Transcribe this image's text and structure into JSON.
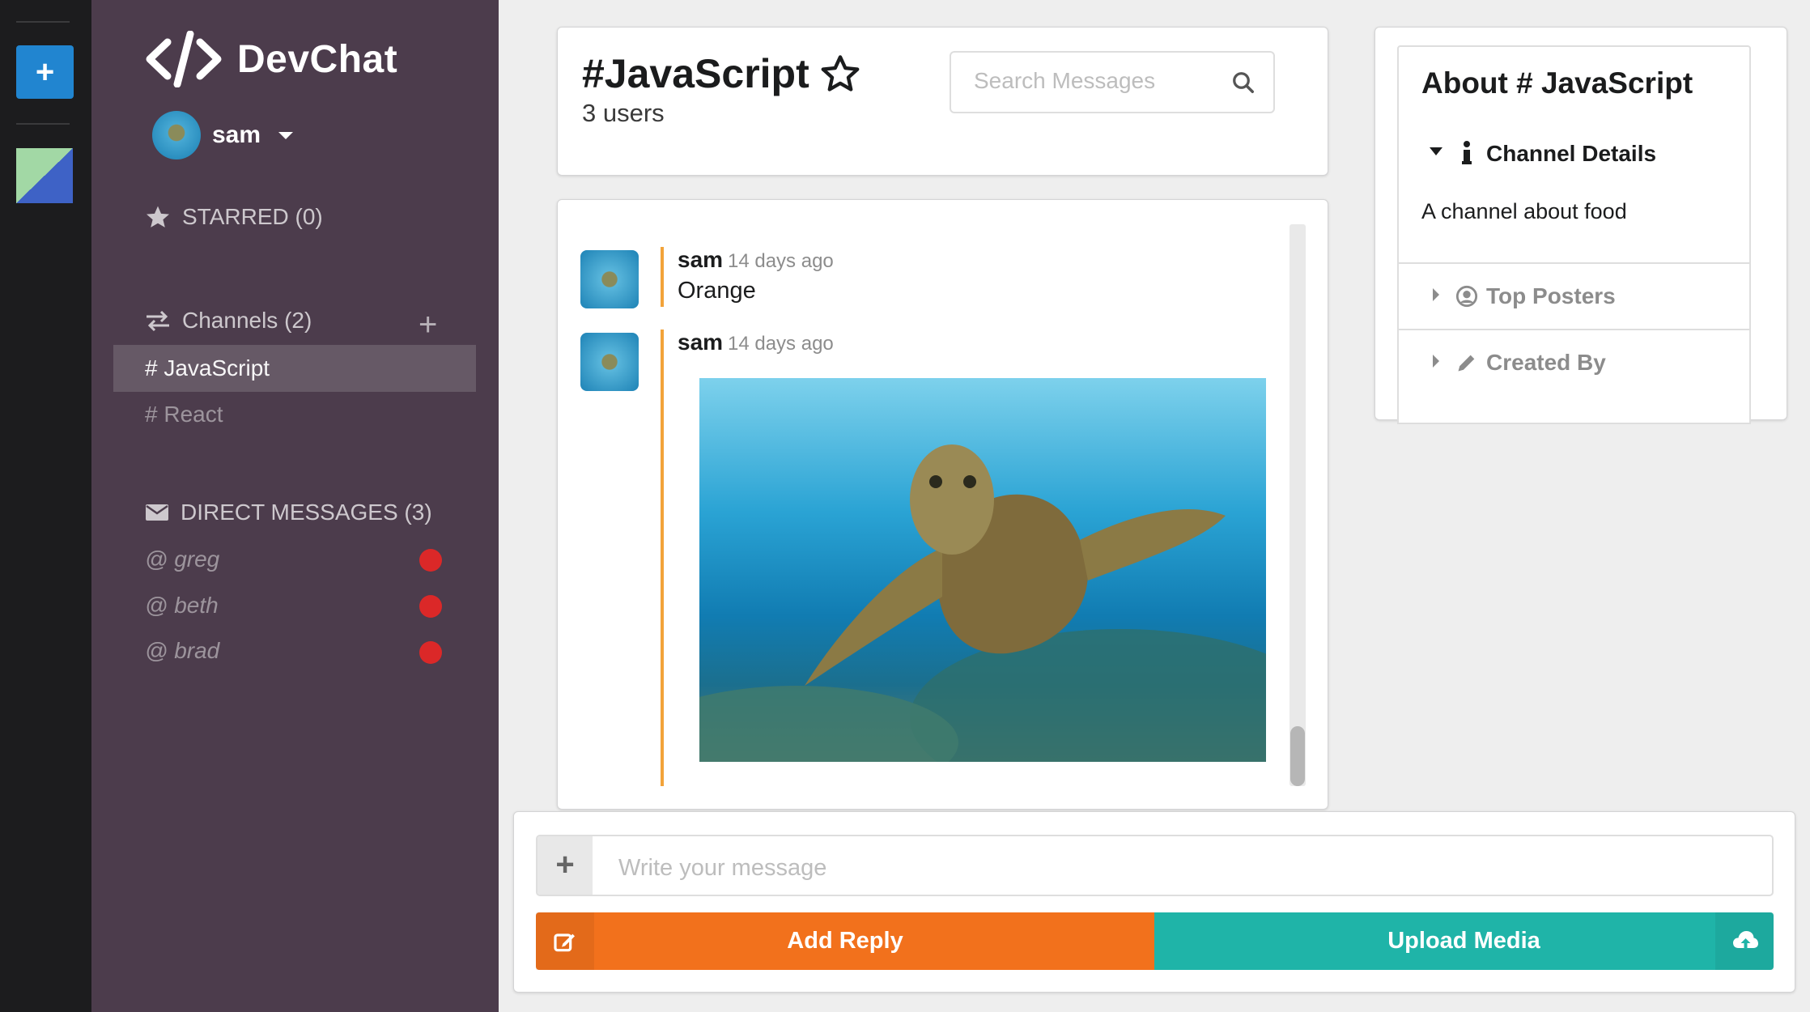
{
  "app": {
    "name": "DevChat"
  },
  "colors": {
    "rail": "#1c1c1e",
    "sidebar": "#4c3c4c",
    "reply": "#f2711c",
    "upload": "#1fb4a8",
    "accent": "#2185d0",
    "dm_status": "#db2828"
  },
  "rail": {
    "add_label": "+"
  },
  "user": {
    "name": "sam"
  },
  "sidebar": {
    "starred_label": "STARRED (0)",
    "channels_label": "Channels (2)",
    "add_channel_label": "+",
    "channels": [
      {
        "label": "# JavaScript",
        "active": true
      },
      {
        "label": "# React",
        "active": false
      }
    ],
    "dm_label": "DIRECT MESSAGES (3)",
    "direct_messages": [
      {
        "label": "@ greg",
        "status": "offline"
      },
      {
        "label": "@ beth",
        "status": "offline"
      },
      {
        "label": "@ brad",
        "status": "offline"
      }
    ]
  },
  "channel": {
    "title": "#JavaScript",
    "users": "3 users",
    "search_placeholder": "Search Messages"
  },
  "messages": [
    {
      "author": "sam",
      "time": "14 days ago",
      "text": "Orange"
    },
    {
      "author": "sam",
      "time": "14 days ago",
      "image": "sea-turtle"
    }
  ],
  "meta_panel": {
    "title": "About # JavaScript",
    "sections": [
      {
        "label": "Channel Details",
        "expanded": true,
        "icon": "info-icon"
      },
      {
        "label": "Top Posters",
        "expanded": false,
        "icon": "user-circle-icon"
      },
      {
        "label": "Created By",
        "expanded": false,
        "icon": "pencil-icon"
      }
    ],
    "details": "A channel about food"
  },
  "form": {
    "add_label": "+",
    "placeholder": "Write your message",
    "reply_label": "Add Reply",
    "upload_label": "Upload Media"
  }
}
